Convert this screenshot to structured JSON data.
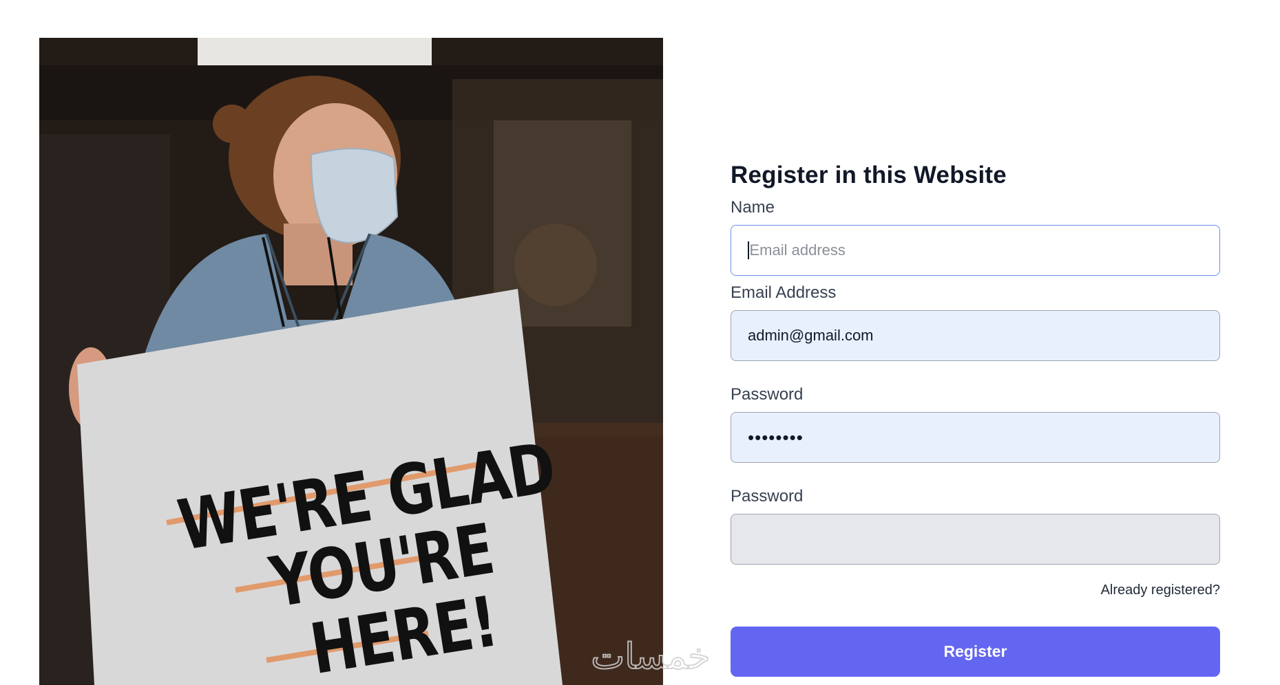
{
  "photo": {
    "sign_lines": [
      "WE'RE GLAD",
      "YOU'RE",
      "HERE!"
    ],
    "alt": "photo-placeholder"
  },
  "form": {
    "title": "Register in this Website",
    "name_label": "Name",
    "name_placeholder": "Email address",
    "name_value": "",
    "email_label": "Email Address",
    "email_value": "admin@gmail.com",
    "password_label": "Password",
    "password_masked": "••••••••",
    "confirm_label": "Password",
    "confirm_value": "",
    "login_link": "Already registered?",
    "submit_label": "Register"
  },
  "watermark": {
    "text": "خمسات"
  },
  "colors": {
    "accent": "#6366f1",
    "focus_border": "#6b8ee8",
    "autofill_bg": "#e8f0fe",
    "disabled_bg": "#e5e7eb"
  }
}
